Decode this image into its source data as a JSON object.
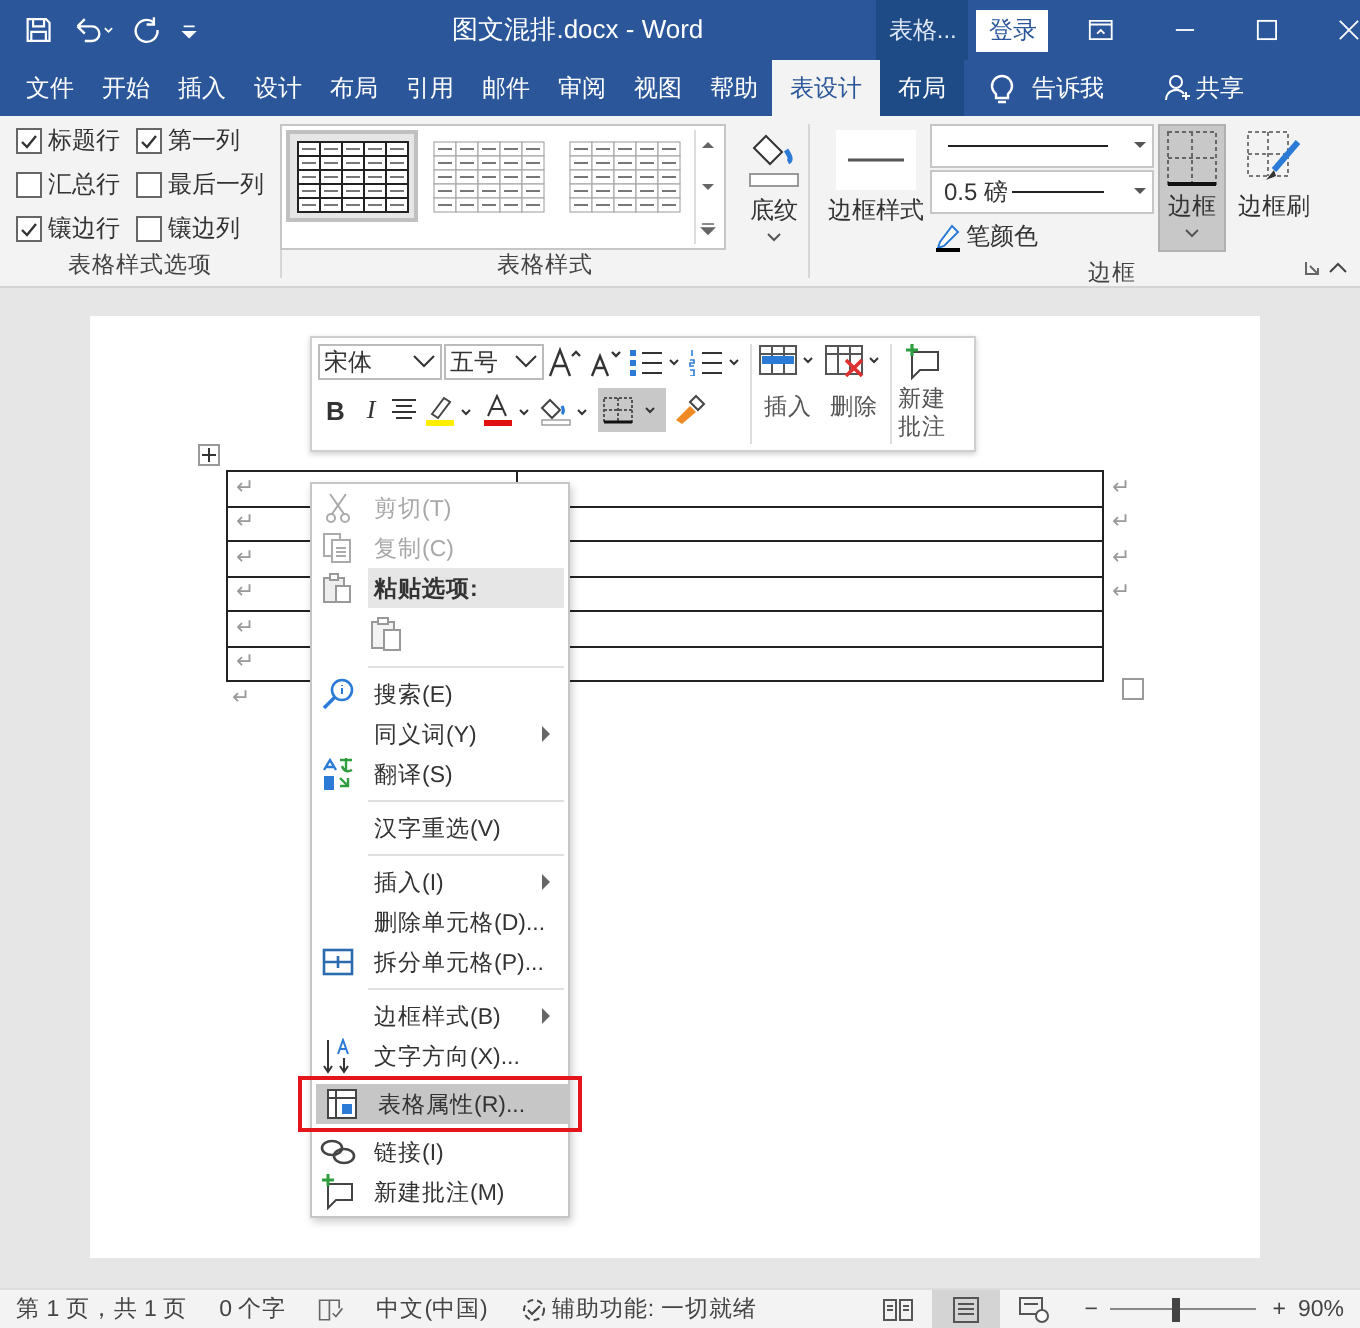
{
  "title_bar": {
    "title": "图文混排.docx  -  Word",
    "context_label": "表格...",
    "sign_in": "登录"
  },
  "tabs": [
    {
      "label": "文件",
      "selected": false,
      "kind": "normal"
    },
    {
      "label": "开始",
      "selected": false,
      "kind": "normal"
    },
    {
      "label": "插入",
      "selected": false,
      "kind": "normal"
    },
    {
      "label": "设计",
      "selected": false,
      "kind": "normal"
    },
    {
      "label": "布局",
      "selected": false,
      "kind": "normal"
    },
    {
      "label": "引用",
      "selected": false,
      "kind": "normal"
    },
    {
      "label": "邮件",
      "selected": false,
      "kind": "normal"
    },
    {
      "label": "审阅",
      "selected": false,
      "kind": "normal"
    },
    {
      "label": "视图",
      "selected": false,
      "kind": "normal"
    },
    {
      "label": "帮助",
      "selected": false,
      "kind": "normal"
    },
    {
      "label": "表设计",
      "selected": true,
      "kind": "contextual"
    },
    {
      "label": "布局",
      "selected": false,
      "kind": "contextual"
    }
  ],
  "tell_me": "告诉我",
  "share": "共享",
  "ribbon": {
    "style_options": {
      "label": "表格样式选项",
      "checkboxes": [
        {
          "label": "标题行",
          "checked": true
        },
        {
          "label": "第一列",
          "checked": true
        },
        {
          "label": "汇总行",
          "checked": false
        },
        {
          "label": "最后一列",
          "checked": false
        },
        {
          "label": "镶边行",
          "checked": true
        },
        {
          "label": "镶边列",
          "checked": false
        }
      ]
    },
    "table_styles": {
      "label": "表格样式",
      "thumbnails": [
        {
          "selected": true
        },
        {
          "selected": false
        },
        {
          "selected": false
        }
      ],
      "shading": "底纹"
    },
    "borders": {
      "label": "边框",
      "border_styles": "边框样式",
      "line_weight": "0.5 磅",
      "pen_color": "笔颜色",
      "borders_button": "边框",
      "borders_selected": true,
      "painter": "边框刷"
    }
  },
  "mini_toolbar": {
    "font": "宋体",
    "size": "五号",
    "bold": "B",
    "italic": "I",
    "insert": "插入",
    "delete": "删除",
    "new_comment": "新建批注",
    "borders_selected": true
  },
  "document": {
    "table_rows": [
      {
        "cell": "↵",
        "end": "↵"
      },
      {
        "cell": "↵",
        "end": "↵"
      },
      {
        "cell": "↵",
        "end": "↵"
      },
      {
        "cell": "↵",
        "end": "↵"
      },
      {
        "cell": "↵"
      },
      {
        "cell": "↵"
      }
    ],
    "after": "↵"
  },
  "context_menu": [
    {
      "kind": "command",
      "label": "剪切(T)",
      "disabled": true,
      "selected": false,
      "submenu": false
    },
    {
      "kind": "command",
      "label": "复制(C)",
      "disabled": true,
      "selected": false,
      "submenu": false
    },
    {
      "kind": "header",
      "label": "粘贴选项:"
    },
    {
      "kind": "paste"
    },
    {
      "kind": "separator"
    },
    {
      "kind": "command",
      "label": "搜索(E)",
      "disabled": false,
      "selected": false,
      "submenu": false
    },
    {
      "kind": "command",
      "label": "同义词(Y)",
      "disabled": false,
      "selected": false,
      "submenu": true
    },
    {
      "kind": "command",
      "label": "翻译(S)",
      "disabled": false,
      "selected": false,
      "submenu": false
    },
    {
      "kind": "separator"
    },
    {
      "kind": "command",
      "label": "汉字重选(V)",
      "disabled": false,
      "selected": false,
      "submenu": false
    },
    {
      "kind": "separator"
    },
    {
      "kind": "command",
      "label": "插入(I)",
      "disabled": false,
      "selected": false,
      "submenu": true
    },
    {
      "kind": "command",
      "label": "删除单元格(D)...",
      "disabled": false,
      "selected": false,
      "submenu": false
    },
    {
      "kind": "command",
      "label": "拆分单元格(P)...",
      "disabled": false,
      "selected": false,
      "submenu": false
    },
    {
      "kind": "separator"
    },
    {
      "kind": "command",
      "label": "边框样式(B)",
      "disabled": false,
      "selected": false,
      "submenu": true
    },
    {
      "kind": "command",
      "label": "文字方向(X)...",
      "disabled": false,
      "selected": false,
      "submenu": false
    },
    {
      "kind": "command",
      "label": "表格属性(R)...",
      "disabled": false,
      "selected": true,
      "submenu": false,
      "annotated": true
    },
    {
      "kind": "command",
      "label": "链接(I)",
      "disabled": false,
      "selected": false,
      "submenu": false
    },
    {
      "kind": "command",
      "label": "新建批注(M)",
      "disabled": false,
      "selected": false,
      "submenu": false
    }
  ],
  "status_bar": {
    "page": "第 1 页，共 1 页",
    "words": "0 个字",
    "language": "中文(中国)",
    "accessibility": "辅助功能: 一切就绪",
    "views": [
      {
        "selected": false
      },
      {
        "selected": true
      },
      {
        "selected": false
      }
    ],
    "zoom_out": "−",
    "zoom_in": "+",
    "zoom": {
      "level": 0.42
    },
    "zoom_percent": "90%"
  }
}
